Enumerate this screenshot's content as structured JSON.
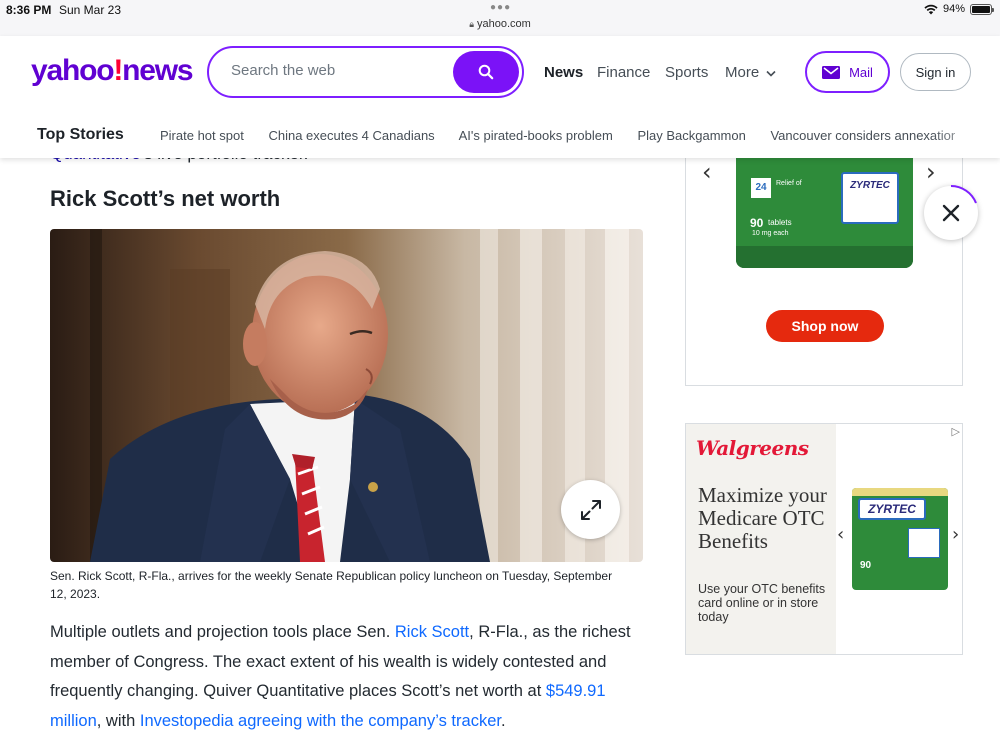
{
  "status_bar": {
    "time": "8:36 PM",
    "date": "Sun Mar 23",
    "url": "yahoo.com",
    "battery": "94%",
    "icons": [
      "wifi-icon",
      "battery-icon",
      "lock-icon"
    ]
  },
  "header": {
    "logo_yahoo": "yahoo",
    "logo_bang": "!",
    "logo_news": "news",
    "search_placeholder": "Search the web",
    "nav": {
      "news": "News",
      "finance": "Finance",
      "sports": "Sports",
      "more": "More"
    },
    "mail_label": "Mail",
    "signin_label": "Sign in",
    "colors": {
      "brand": "#6001d2",
      "accent": "#7e1fff",
      "bang": "#ff0033"
    }
  },
  "top_stories": {
    "title": "Top Stories",
    "items": [
      "Pirate hot spot",
      "China executes 4 Canadians",
      "AI's pirated-books problem",
      "Play Backgammon",
      "Vancouver considers annexation"
    ]
  },
  "article": {
    "partial_link": "Quantitative",
    "partial_text": "'s live portfolio tracker.",
    "heading": "Rick Scott’s net worth",
    "photo_caption": "Sen. Rick Scott, R-Fla., arrives for the weekly Senate Republican policy luncheon on Tuesday, September 12, 2023.",
    "para_1": "Multiple outlets and projection tools place Sen. ",
    "link_rick_scott": "Rick Scott",
    "para_2": ", R-Fla., as the richest member of Congress. The exact extent of his wealth is widely contested and frequently changing. Quiver Quantitative places Scott’s net worth at ",
    "link_networth": "$549.91 million",
    "para_3": ", with ",
    "link_investopedia": "Investopedia agreeing with the company’s tracker",
    "para_4": "."
  },
  "ad_top": {
    "shop_now": "Shop now",
    "product_brand": "ZYRTEC",
    "product_count": "90",
    "product_count_label": "tablets",
    "product_dose": "10 mg each",
    "box_24": "24",
    "box_relief": "Relief of"
  },
  "ad_bottom": {
    "brand": "Walgreens",
    "headline": "Maximize your Medicare OTC Benefits",
    "subtext": "Use your OTC benefits card online or in store today",
    "product_brand": "ZYRTEC",
    "product_count": "90"
  }
}
